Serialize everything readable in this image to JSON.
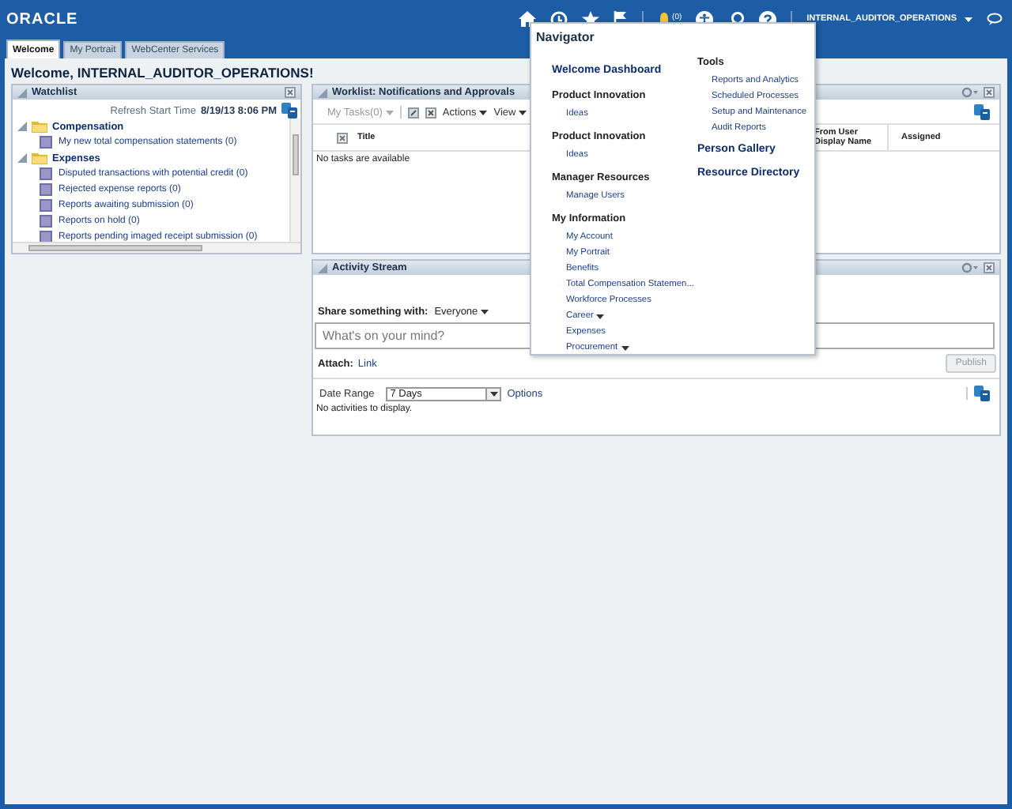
{
  "header": {
    "logo": "ORACLE",
    "notifications": "(0)",
    "user": "INTERNAL_AUDITOR_OPERATIONS"
  },
  "tabs": [
    {
      "label": "Welcome",
      "selected": true
    },
    {
      "label": "My Portrait",
      "selected": false
    },
    {
      "label": "WebCenter Services",
      "selected": false
    }
  ],
  "greeting": "Welcome, INTERNAL_AUDITOR_OPERATIONS!",
  "watchlist": {
    "title": "Watchlist",
    "refresh_label": "Refresh Start Time",
    "refresh_time": "8/19/13 8:06 PM",
    "groups": [
      {
        "label": "Compensation",
        "expanded": true,
        "children": [
          {
            "label": "My new total compensation statements (0)"
          }
        ]
      },
      {
        "label": "Expenses",
        "expanded": true,
        "children": [
          {
            "label": "Disputed transactions with potential credit (0)"
          },
          {
            "label": "Rejected expense reports (0)"
          },
          {
            "label": "Reports awaiting submission (0)"
          },
          {
            "label": "Reports on hold (0)"
          },
          {
            "label": "Reports pending imaged receipt submission (0)"
          }
        ]
      }
    ]
  },
  "worklist": {
    "title": "Worklist: Notifications and Approvals",
    "my_tasks": "My Tasks(0)",
    "my_tasks_disabled": true,
    "actions": "Actions",
    "view": "View",
    "columns": [
      "Title",
      "From User Display Name",
      "Assigned"
    ],
    "empty_text": "No tasks are available"
  },
  "activity_stream": {
    "title": "Activity Stream",
    "share_label": "Share something with:",
    "share_target": "Everyone",
    "placeholder": "What's on your mind?",
    "attach_label": "Attach:",
    "attach_link": "Link",
    "publish": "Publish",
    "publish_disabled": true,
    "date_range_label": "Date Range",
    "date_range": "7 Days",
    "options": "Options",
    "empty_text": "No activities to display."
  },
  "navigator": {
    "title": "Navigator",
    "columns": [
      [
        {
          "heading": "Welcome Dashboard",
          "kind": "link"
        },
        {
          "heading": "Product Innovation",
          "kind": "group",
          "items": [
            {
              "label": "Ideas",
              "submenu": false
            }
          ]
        },
        {
          "heading": "Product Innovation",
          "kind": "group",
          "items": [
            {
              "label": "Ideas",
              "submenu": false
            }
          ]
        },
        {
          "heading": "Manager Resources",
          "kind": "group",
          "items": [
            {
              "label": "Manage Users",
              "submenu": false
            }
          ]
        },
        {
          "heading": "My Information",
          "kind": "group",
          "items": [
            {
              "label": "My Account",
              "submenu": false
            },
            {
              "label": "My Portrait",
              "submenu": false
            },
            {
              "label": "Benefits",
              "submenu": false
            },
            {
              "label": "Total Compensation Statemen...",
              "submenu": false
            },
            {
              "label": "Workforce Processes",
              "submenu": false
            },
            {
              "label": "Career",
              "submenu": true
            },
            {
              "label": "Expenses",
              "submenu": false
            },
            {
              "label": "Procurement",
              "submenu": true
            }
          ]
        }
      ],
      [
        {
          "heading": "Tools",
          "kind": "group",
          "items": [
            {
              "label": "Reports and Analytics",
              "submenu": false
            },
            {
              "label": "Scheduled Processes",
              "submenu": false
            },
            {
              "label": "Setup and Maintenance",
              "submenu": false
            },
            {
              "label": "Audit Reports",
              "submenu": false
            }
          ]
        },
        {
          "heading": "Person Gallery",
          "kind": "link"
        },
        {
          "heading": "Resource Directory",
          "kind": "link"
        }
      ]
    ]
  }
}
